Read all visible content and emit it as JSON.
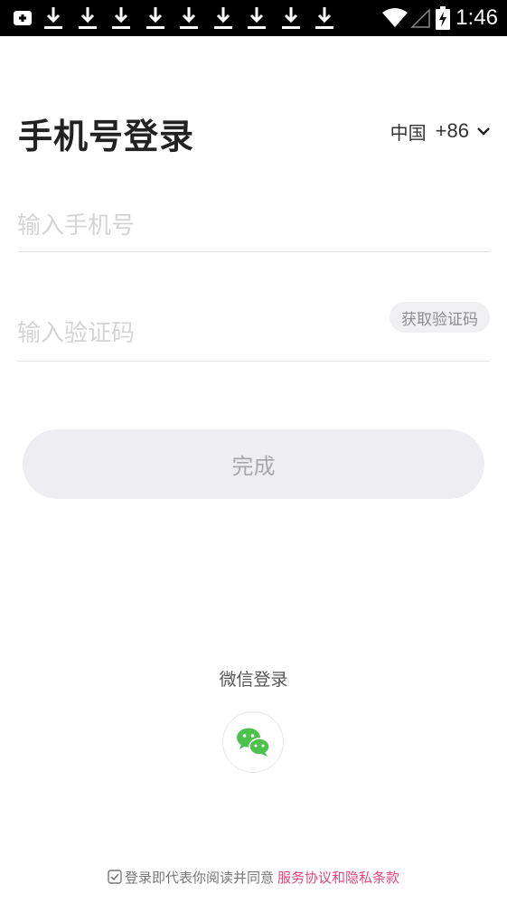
{
  "status_bar": {
    "time": "1:46",
    "notification_icons": [
      "app-icon",
      "download-icon",
      "download-icon",
      "download-icon",
      "download-icon",
      "download-icon",
      "download-icon",
      "download-icon",
      "download-icon",
      "download-icon"
    ],
    "system_icons": [
      "wifi-icon",
      "signal-icon",
      "battery-charging-icon"
    ]
  },
  "header": {
    "title": "手机号登录",
    "country_name": "中国",
    "country_code": "+86"
  },
  "form": {
    "phone_placeholder": "输入手机号",
    "phone_value": "",
    "code_placeholder": "输入验证码",
    "code_value": "",
    "get_code_label": "获取验证码",
    "done_label": "完成"
  },
  "wechat": {
    "label": "微信登录",
    "icon": "wechat-icon",
    "brand_color": "#4cc24d"
  },
  "agreement": {
    "prefix": "登录即代表你阅读并同意",
    "link_text": "服务协议和隐私条款",
    "link_color": "#e8457a"
  }
}
